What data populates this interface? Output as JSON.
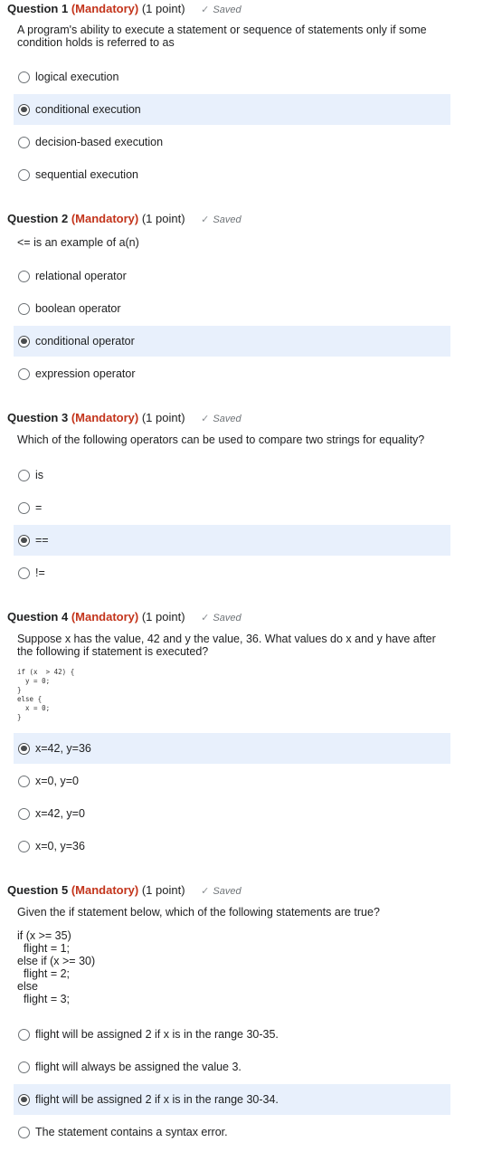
{
  "common": {
    "mandatory": "(Mandatory)",
    "points": "(1 point)",
    "saved": "Saved"
  },
  "questions": [
    {
      "number": "Question 1",
      "text": "A program's ability to execute a statement or sequence of statements only if some condition holds is referred to as",
      "options": [
        "logical execution",
        "conditional execution",
        "decision-based execution",
        "sequential execution"
      ],
      "selected": 1
    },
    {
      "number": "Question 2",
      "text": "<= is an example of a(n)",
      "options": [
        "relational operator",
        "boolean operator",
        "conditional operator",
        "expression operator"
      ],
      "selected": 2
    },
    {
      "number": "Question 3",
      "text": "Which of the following operators can be used to compare two strings for equality?",
      "options": [
        "is",
        "=",
        "==",
        "!="
      ],
      "selected": 2
    },
    {
      "number": "Question 4",
      "text": "Suppose x has the value, 42 and y the value, 36. What values do x and y have after the following if statement is executed?",
      "code": "if (x  > 42) {\n  y = 0;\n}\nelse {\n  x = 0;\n}",
      "options": [
        "x=42, y=36",
        "x=0, y=0",
        "x=42, y=0",
        "x=0, y=36"
      ],
      "selected": 0
    },
    {
      "number": "Question 5",
      "text": "Given the if statement below, which of the following statements are true?",
      "code": "if (x >= 35)\n  flight = 1;\nelse if (x >= 30)\n  flight = 2;\nelse\n  flight = 3;",
      "options": [
        "flight will be assigned 2 if x is in the range 30-35.",
        "flight will always be assigned the value 3.",
        "flight will be assigned 2 if x is in the range 30-34.",
        "The statement contains a syntax error."
      ],
      "selected": 2
    }
  ]
}
